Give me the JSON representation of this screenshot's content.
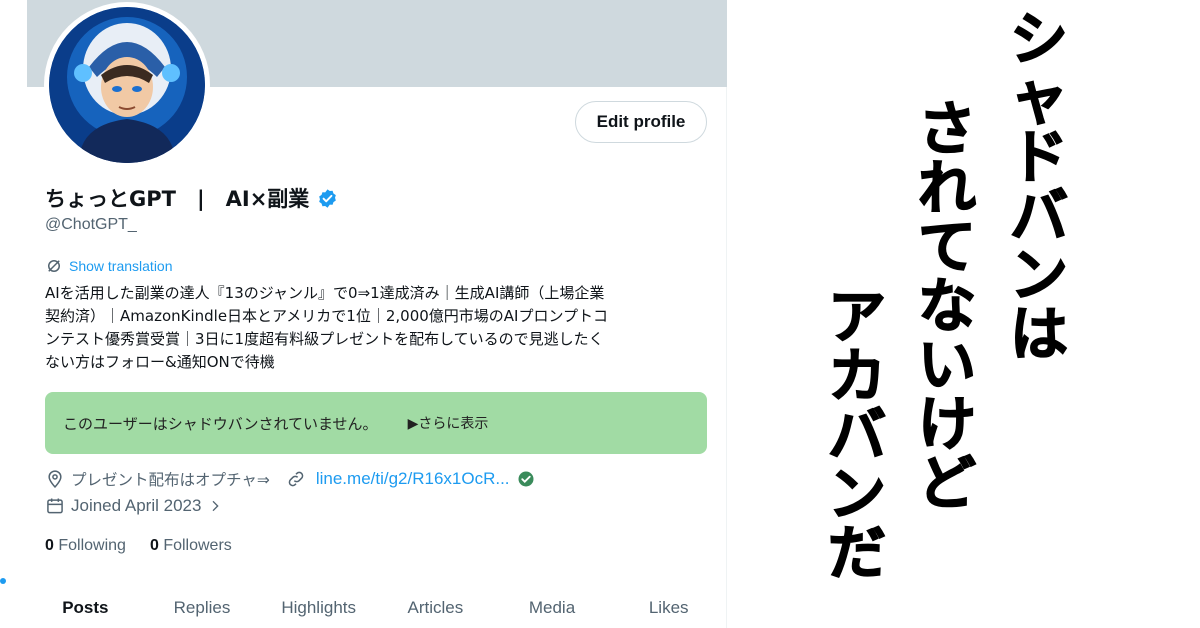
{
  "profile": {
    "edit_label": "Edit profile",
    "display_name": "ちょっとGPT　|　AI×副業",
    "handle": "@ChotGPT_",
    "show_translation": "Show translation",
    "bio_lines": [
      "AIを活用した副業の達人『13のジャンル』で0⇒1達成済み｜生成AI講師（上場企業",
      "契約済）｜AmazonKindle日本とアメリカで1位｜2,000億円市場のAIプロンプトコ",
      "ンテスト優秀賞受賞｜3日に1度超有料級プレゼントを配布しているので見逃したく",
      "ない方はフォロー&通知ONで待機"
    ],
    "shadowban_text": "このユーザーはシャドウバンされていません。",
    "shadowban_more": "▶さらに表示",
    "location": "プレゼント配布はオプチャ⇒",
    "link": "line.me/ti/g2/R16x1OcR...",
    "joined": "Joined April 2023",
    "following_count": "0",
    "following_label": "Following",
    "followers_count": "0",
    "followers_label": "Followers"
  },
  "tabs": [
    {
      "label": "Posts",
      "active": true
    },
    {
      "label": "Replies"
    },
    {
      "label": "Highlights"
    },
    {
      "label": "Articles"
    },
    {
      "label": "Media"
    },
    {
      "label": "Likes"
    }
  ],
  "caption": {
    "col1": [
      "シ",
      "ャ",
      "ド",
      "バ",
      "ン",
      "は"
    ],
    "col2": [
      "さ",
      "れ",
      "て",
      "な",
      "い",
      "け",
      "ど"
    ],
    "col3": [
      "ア",
      "カ",
      "バ",
      "ン",
      "だ"
    ]
  },
  "colors": {
    "accent": "#1d9bf0",
    "shadowban_box": "#a1dba4",
    "banner": "#cfd9de",
    "verified": "#1d9bf0"
  }
}
